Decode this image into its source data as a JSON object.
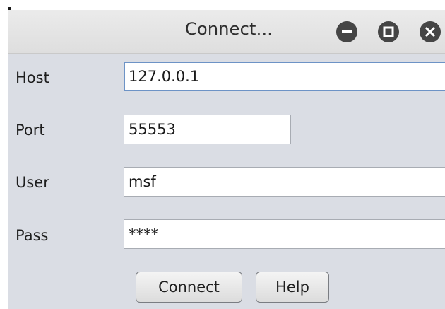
{
  "window": {
    "title": "Connect...",
    "controls": [
      "minimize-icon",
      "maximize-icon",
      "close-icon"
    ]
  },
  "form": {
    "host_label": "Host",
    "host_value": "127.0.0.1",
    "port_label": "Port",
    "port_value": "55553",
    "user_label": "User",
    "user_value": "msf",
    "pass_label": "Pass",
    "pass_value": "****"
  },
  "buttons": {
    "connect_label": "Connect",
    "help_label": "Help"
  },
  "colors": {
    "titlebar": "#e4e4e4",
    "content_bg": "#dadde4",
    "window_control": "#454545",
    "focus_border": "#6d93c6"
  }
}
